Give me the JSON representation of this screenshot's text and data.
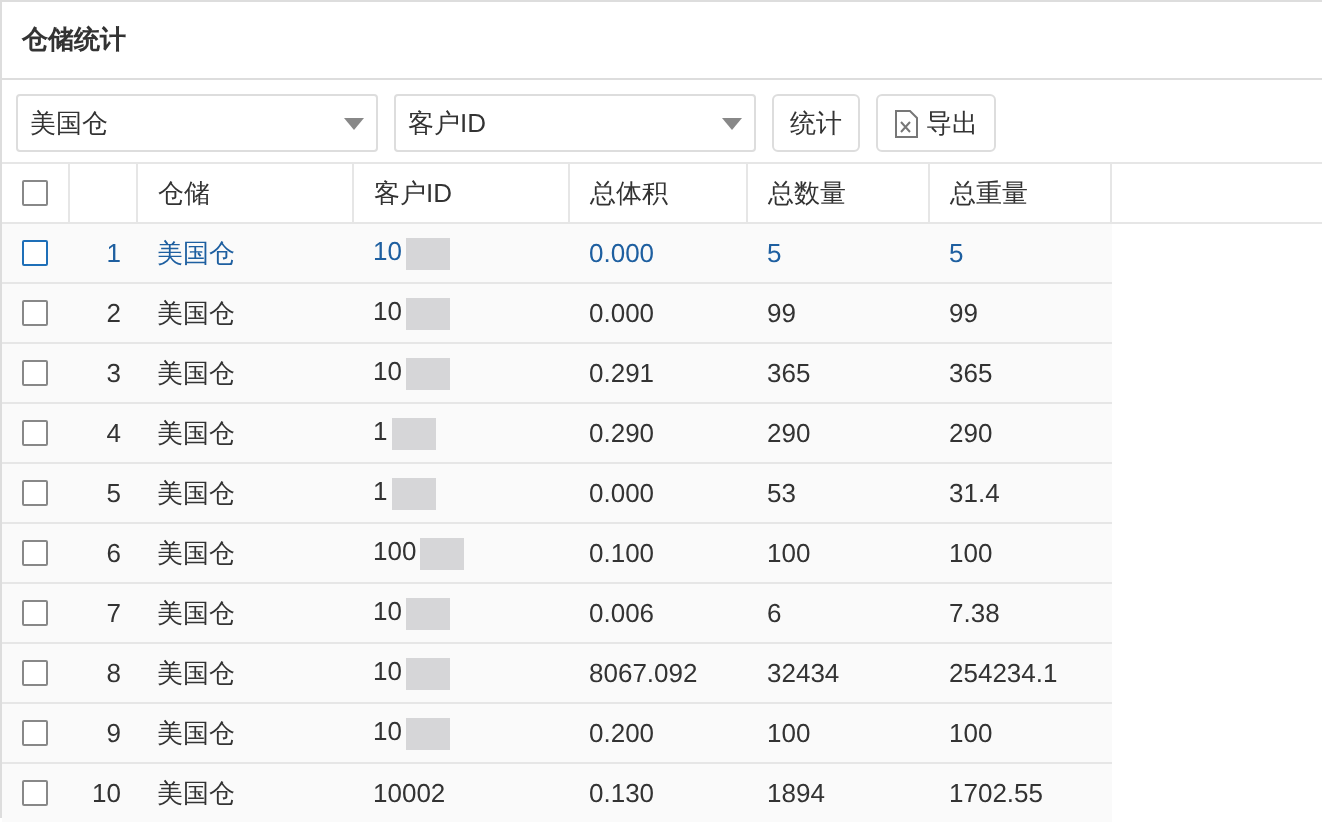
{
  "panel": {
    "title": "仓储统计"
  },
  "toolbar": {
    "warehouse_select": {
      "value": "美国仓"
    },
    "customer_select": {
      "placeholder": "客户ID"
    },
    "buttons": [
      {
        "label": "统计",
        "kind": "text"
      },
      {
        "label": "导出",
        "kind": "export"
      }
    ]
  },
  "table": {
    "all_checked": false,
    "columns": [
      "仓储",
      "客户ID",
      "总体积",
      "总数量",
      "总重量"
    ],
    "rows": [
      {
        "index": "1",
        "cells": [
          "美国仓",
          "10",
          "0.000",
          "5",
          "5"
        ],
        "checked": false,
        "highlighted": true
      },
      {
        "index": "2",
        "cells": [
          "美国仓",
          "10",
          "0.000",
          "99",
          "99"
        ],
        "checked": false,
        "highlighted": false
      },
      {
        "index": "3",
        "cells": [
          "美国仓",
          "10",
          "0.291",
          "365",
          "365"
        ],
        "checked": false,
        "highlighted": false
      },
      {
        "index": "4",
        "cells": [
          "美国仓",
          "1",
          "0.290",
          "290",
          "290"
        ],
        "checked": false,
        "highlighted": false
      },
      {
        "index": "5",
        "cells": [
          "美国仓",
          "1",
          "0.000",
          "53",
          "31.4"
        ],
        "checked": false,
        "highlighted": false
      },
      {
        "index": "6",
        "cells": [
          "美国仓",
          "100",
          "0.100",
          "100",
          "100"
        ],
        "checked": false,
        "highlighted": false
      },
      {
        "index": "7",
        "cells": [
          "美国仓",
          "10",
          "0.006",
          "6",
          "7.38"
        ],
        "checked": false,
        "highlighted": false
      },
      {
        "index": "8",
        "cells": [
          "美国仓",
          "10",
          "8067.092",
          "32434",
          "254234.1"
        ],
        "checked": false,
        "highlighted": false
      },
      {
        "index": "9",
        "cells": [
          "美国仓",
          "10",
          "0.200",
          "100",
          "100"
        ],
        "checked": false,
        "highlighted": false
      },
      {
        "index": "10",
        "cells": [
          "美国仓",
          "10002",
          "0.130",
          "1894",
          "1702.55"
        ],
        "checked": false,
        "highlighted": false
      }
    ]
  }
}
